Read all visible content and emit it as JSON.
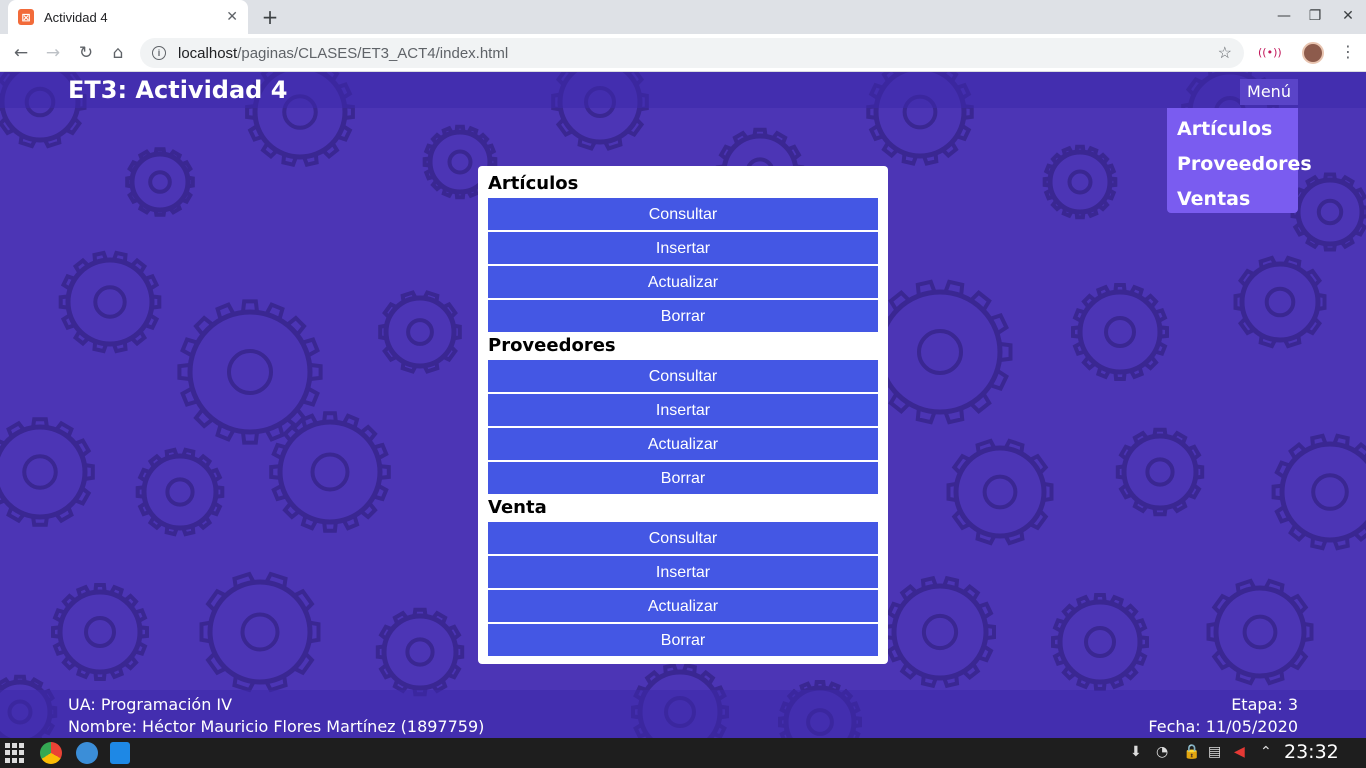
{
  "browser": {
    "tab_title": "Actividad 4",
    "url_host": "localhost",
    "url_path": "/paginas/CLASES/ET3_ACT4/index.html"
  },
  "header": {
    "title": "ET3: Actividad 4",
    "menu_label": "Menú",
    "menu_items": [
      "Artículos",
      "Proveedores",
      "Ventas"
    ]
  },
  "sections": [
    {
      "title": "Artículos",
      "buttons": [
        "Consultar",
        "Insertar",
        "Actualizar",
        "Borrar"
      ]
    },
    {
      "title": "Proveedores",
      "buttons": [
        "Consultar",
        "Insertar",
        "Actualizar",
        "Borrar"
      ]
    },
    {
      "title": "Venta",
      "buttons": [
        "Consultar",
        "Insertar",
        "Actualizar",
        "Borrar"
      ]
    }
  ],
  "footer": {
    "ua": "UA: Programación IV",
    "nombre": "Nombre: Héctor Mauricio Flores Martínez (1897759)",
    "etapa": "Etapa: 3",
    "fecha": "Fecha: 11/05/2020"
  },
  "taskbar": {
    "clock": "23:32"
  },
  "colors": {
    "page_bg": "#4c35b5",
    "button": "#4457e4",
    "dropdown": "#7a5cf0"
  }
}
